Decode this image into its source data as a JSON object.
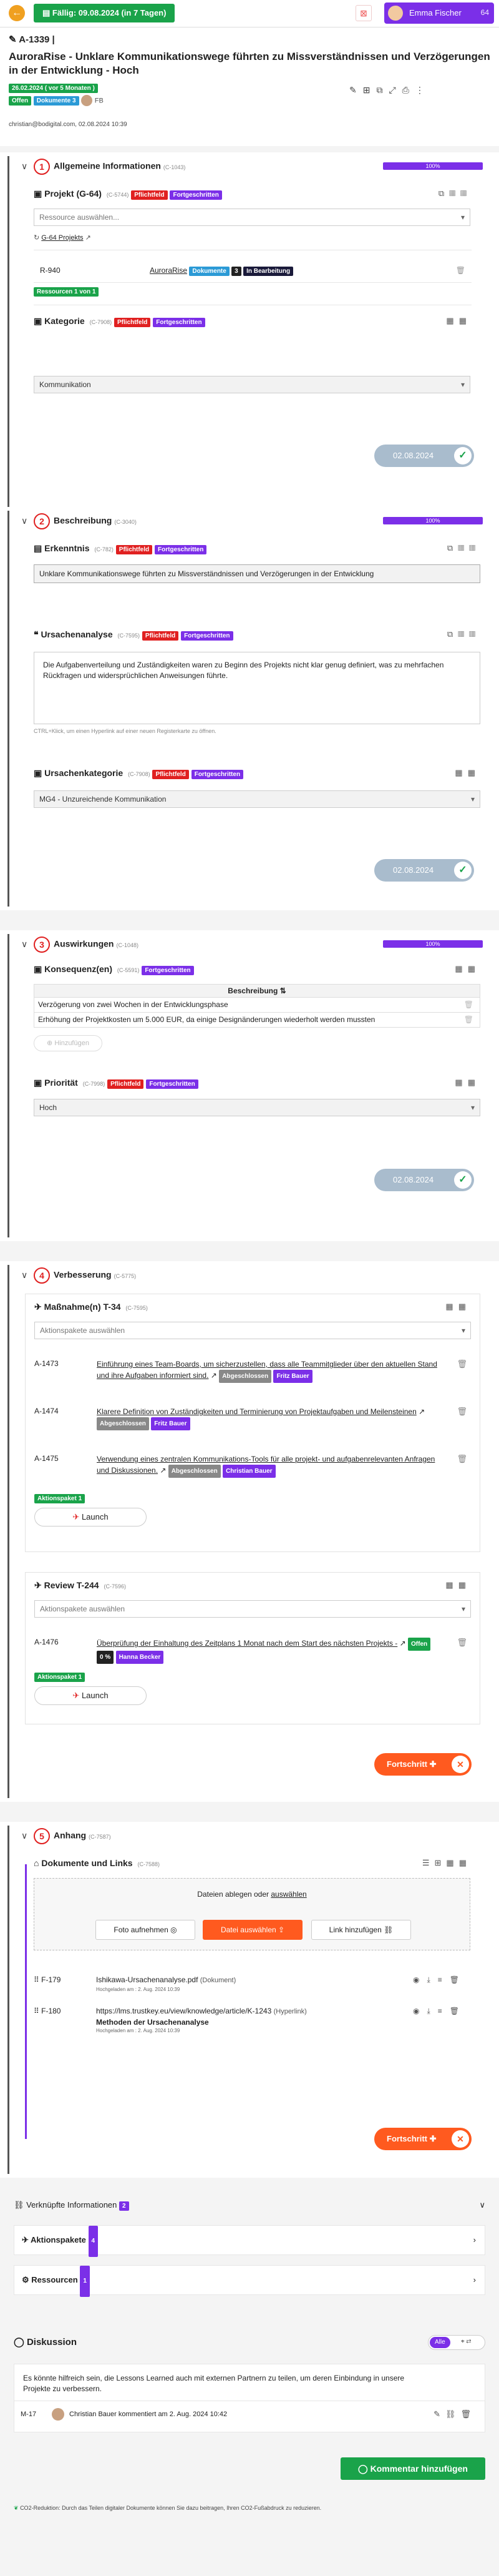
{
  "topbar": {
    "due_label": "Fällig: 09.08.2024 (in 7 Tagen)",
    "user_name": "Emma Fischer",
    "user_count": "64"
  },
  "header": {
    "id": "A-1339 |",
    "title": "AuroraRise - Unklare Kommunikationswege führten zu Missverständnissen und Verzögerungen in der Entwicklung - Hoch",
    "dates_badge": "26.02.2024 ( vor 5 Monaten )",
    "status_badge": "Offen",
    "docs_badge": "Dokumente",
    "docs_count": "3",
    "meta": "christian@bodigital.com, 02.08.2024 10:39"
  },
  "labels": {
    "pflichtfeld": "Pflichtfeld",
    "fortgeschritten": "Fortgeschritten",
    "progress_100": "100%",
    "done_date": "02.08.2024",
    "fortschritt": "Fortschritt",
    "launch": "Launch",
    "aktionspakete_placeholder": "Aktionspakete auswählen",
    "abgeschlossen": "Abgeschlossen",
    "aktionspaket_1": "Aktionspaket 1"
  },
  "s1": {
    "num": "1",
    "title": "Allgemeine Informationen",
    "code": "(C-1043)",
    "projekt_title": "Projekt (G-64)",
    "projekt_code": "(C-5744)",
    "ressource_placeholder": "Ressource auswählen...",
    "projekt_link": "G-64 Projekts",
    "row_id": "R-940",
    "row_name": "AuroraRise",
    "row_docs": "Dokumente",
    "row_docs_count": "3",
    "row_status": "In Bearbeitung",
    "ressourcen_badge": "Ressourcen 1 von 1",
    "kategorie_title": "Kategorie",
    "kategorie_code": "(C-7908)",
    "kategorie_value": "Kommunikation"
  },
  "s2": {
    "num": "2",
    "title": "Beschreibung",
    "code": "(C-3040)",
    "erkenntnis_title": "Erkenntnis",
    "erkenntnis_code": "(C-782)",
    "erkenntnis_value": "Unklare Kommunikationswege führten zu Missverständnissen und Verzögerungen in der Entwicklung",
    "ursachen_title": "Ursachenanalyse",
    "ursachen_code": "(C-7595)",
    "ursachen_text": "Die Aufgabenverteilung und Zuständigkeiten waren zu Beginn des Projekts nicht klar genug definiert, was zu mehrfachen Rückfragen und widersprüchlichen Anweisungen führte.",
    "ursachen_hint": "CTRL+Klick, um einen Hyperlink auf einer neuen Registerkarte zu öffnen.",
    "kategorie2_title": "Ursachenkategorie",
    "kategorie2_code": "(C-7908)",
    "kategorie2_value": "MG4 - Unzureichende Kommunikation"
  },
  "s3": {
    "num": "3",
    "title": "Auswirkungen",
    "code": "(C-1048)",
    "konsequenz_title": "Konsequenz(en)",
    "konsequenz_code": "(C-5591)",
    "table_header": "Beschreibung",
    "rows": [
      "Verzögerung von zwei Wochen in der Entwicklungsphase",
      "Erhöhung der Projektkosten um 5.000 EUR, da einige Designänderungen wiederholt werden mussten"
    ],
    "add_label": "Hinzufügen",
    "prioritaet_title": "Priorität",
    "prioritaet_code": "(C-7998)",
    "prioritaet_value": "Hoch"
  },
  "s4": {
    "num": "4",
    "title": "Verbesserung",
    "code": "(C-5775)",
    "massnahmen_title": "Maßnahme(n) T-34",
    "massnahmen_code": "(C-7595)",
    "items": [
      {
        "id": "A-1473",
        "text": "Einführung eines Team-Boards, um sicherzustellen, dass alle Teammitglieder über den aktuellen Stand und ihre Aufgaben informiert sind.",
        "person": "Fritz Bauer"
      },
      {
        "id": "A-1474",
        "text": "Klarere Definition von Zuständigkeiten und Terminierung von Projektaufgaben und Meilensteinen",
        "person": "Fritz Bauer"
      },
      {
        "id": "A-1475",
        "text": "Verwendung eines zentralen Kommunikations-Tools für alle projekt- und aufgabenrelevanten Anfragen und Diskussionen.",
        "person": "Christian Bauer"
      }
    ],
    "review_title": "Review T-244",
    "review_code": "(C-7596)",
    "review_item": {
      "id": "A-1476",
      "text": "Überprüfung der Einhaltung des Zeitplans 1 Monat nach dem Start des nächsten Projekts -",
      "status": "Offen",
      "pct": "0 %",
      "person": "Hanna Becker"
    }
  },
  "s5": {
    "num": "5",
    "title": "Anhang",
    "code": "(C-7587)",
    "docs_title": "Dokumente und Links",
    "docs_code": "(C-7588)",
    "drop_text_a": "Dateien ablegen oder ",
    "drop_text_b": "auswählen",
    "foto_btn": "Foto aufnehmen",
    "datei_btn": "Datei auswählen",
    "link_btn": "Link hinzufügen",
    "files": [
      {
        "id": "F-179",
        "name": "Ishikawa-Ursachenanalyse.pdf",
        "kind": "(Dokument)",
        "meta": "Hochgeladen am : 2. Aug. 2024 10:39",
        "extra": ""
      },
      {
        "id": "F-180",
        "name": "https://lms.trustkey.eu/view/knowledge/article/K-1243",
        "kind": "(Hyperlink)",
        "meta": "Hochgeladen am : 2. Aug. 2024 10:39",
        "extra": "Methoden der Ursachenanalyse"
      }
    ]
  },
  "linked": {
    "title": "Verknüpfte Informationen",
    "count": "2",
    "aktionspakete": "Aktionspakete",
    "aktionspakete_count": "4",
    "ressourcen": "Ressourcen",
    "ressourcen_count": "1"
  },
  "discussion": {
    "title": "Diskussion",
    "filter_all": "Alle",
    "comment_text": "Es könnte hilfreich sein, die Lessons Learned auch mit externen Partnern zu teilen, um deren Einbindung in unsere Projekte zu verbessern.",
    "comment_id": "M-17",
    "comment_meta": "Christian Bauer kommentiert am 2. Aug. 2024 10:42",
    "add_button": "Kommentar hinzufügen"
  },
  "footer": {
    "co2": "CO2-Reduktion: Durch das Teilen digitaler Dokumente können Sie dazu beitragen, Ihren CO2-Fußabdruck zu reduzieren."
  }
}
